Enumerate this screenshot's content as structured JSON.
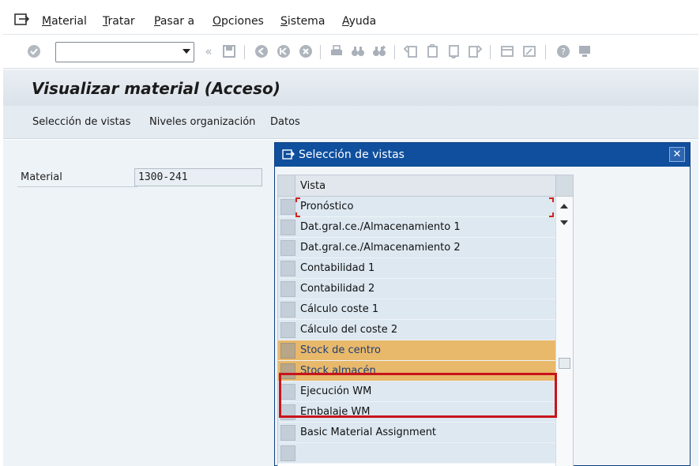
{
  "menubar": {
    "items": [
      {
        "label": "Material",
        "accel": "M",
        "rest": "aterial"
      },
      {
        "label": "Tratar",
        "accel": "T",
        "rest": "ratar"
      },
      {
        "label": "Pasar a",
        "accel": "P",
        "rest": "asar a"
      },
      {
        "label": "Opciones",
        "accel": "O",
        "rest": "pciones"
      },
      {
        "label": "Sistema",
        "accel": "S",
        "rest": "istema"
      },
      {
        "label": "Ayuda",
        "accel": "A",
        "rest": "yuda"
      }
    ]
  },
  "toolbar": {
    "command_field_value": ""
  },
  "screen": {
    "title": "Visualizar material (Acceso)"
  },
  "appbar": {
    "buttons": [
      "Selección de vistas",
      "Niveles organización",
      "Datos"
    ]
  },
  "form": {
    "material_label": "Material",
    "material_value": "1300-241"
  },
  "dialog": {
    "title": "Selección de vistas",
    "close_label": "✕",
    "column_header": "Vista",
    "rows": [
      "Pronóstico",
      "Dat.gral.ce./Almacenamiento 1",
      "Dat.gral.ce./Almacenamiento 2",
      "Contabilidad 1",
      "Contabilidad 2",
      "Cálculo coste 1",
      "Cálculo del coste 2",
      "Stock de centro",
      "Stock almacén",
      "Ejecución WM",
      "Embalaje WM",
      "Basic Material Assignment",
      "",
      ""
    ],
    "highlight_color": "#c8141b",
    "selected_row_color": "#e8b86b"
  }
}
